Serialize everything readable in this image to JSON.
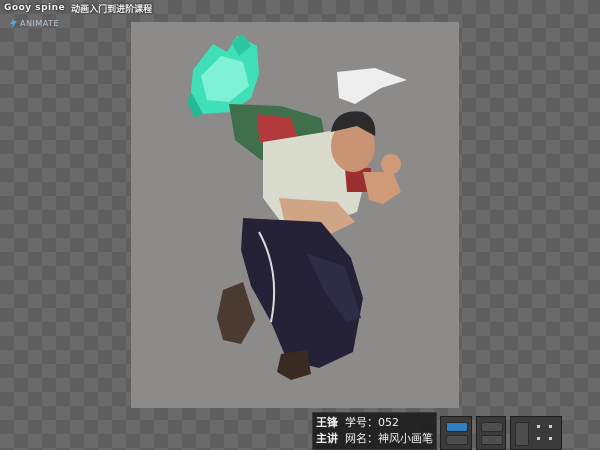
{
  "brand": {
    "logo_text": "Gooy spine",
    "course_title": "动画入门到进阶课程"
  },
  "mode": {
    "label": "ANIMATE",
    "icon": "lightning-icon"
  },
  "info_panel": {
    "instructor_line1": "王锋",
    "instructor_line2": "主讲",
    "student_id": "学号：052",
    "nickname": "网名：神风小画笔"
  },
  "colors": {
    "canvas_bg": "#8d8a8a",
    "workspace_bg": "#5f5f5f",
    "accent": "#2f7fc2",
    "crystal": "#3fe0b8"
  }
}
